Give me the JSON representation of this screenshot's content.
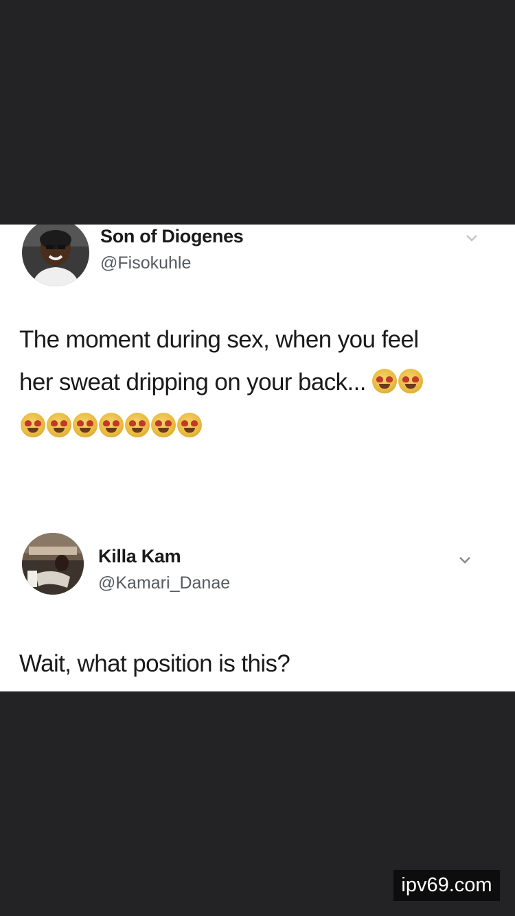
{
  "tweets": [
    {
      "name": "Son of Diogenes",
      "handle": "@Fisokuhle",
      "text_line1": "The moment during sex, when you feel",
      "text_line2": "her sweat dripping on your back...",
      "emoji_inline_count": 2,
      "emoji_row_count": 7,
      "avatar_icon": "person-avatar-icon",
      "menu_icon": "chevron-down-icon"
    },
    {
      "name": "Killa Kam",
      "handle": "@Kamari_Danae",
      "text": "Wait, what position is this?",
      "avatar_icon": "person-avatar-icon",
      "menu_icon": "chevron-down-icon"
    }
  ],
  "watermark": "ipv69.com",
  "colors": {
    "background": "#232325",
    "card": "#ffffff",
    "text": "#1a1a1a",
    "handle": "#555b61"
  }
}
